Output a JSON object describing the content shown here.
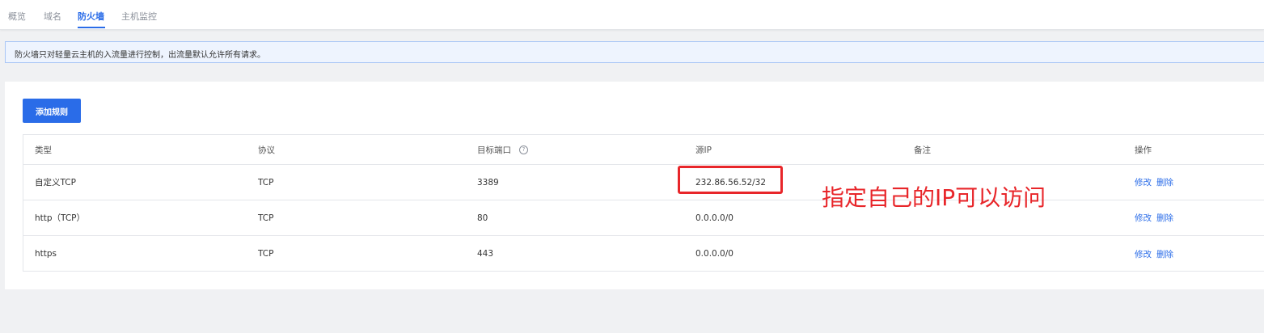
{
  "tabs": [
    {
      "label": "概览",
      "active": false
    },
    {
      "label": "域名",
      "active": false
    },
    {
      "label": "防火墙",
      "active": true
    },
    {
      "label": "主机监控",
      "active": false
    }
  ],
  "notice": {
    "text": "防火墙只对轻量云主机的入流量进行控制，出流量默认允许所有请求。"
  },
  "toolbar": {
    "add_rule_label": "添加规则"
  },
  "table": {
    "headers": {
      "type": "类型",
      "protocol": "协议",
      "port": "目标端口",
      "source_ip": "源IP",
      "remark": "备注",
      "actions": "操作"
    },
    "help_icon": "question-circle-icon",
    "rows": [
      {
        "type": "自定义TCP",
        "protocol": "TCP",
        "port": "3389",
        "source_ip": "232.86.56.52/32",
        "remark": "",
        "edit": "修改",
        "delete": "删除"
      },
      {
        "type": "http（TCP）",
        "protocol": "TCP",
        "port": "80",
        "source_ip": "0.0.0.0/0",
        "remark": "",
        "edit": "修改",
        "delete": "删除"
      },
      {
        "type": "https",
        "protocol": "TCP",
        "port": "443",
        "source_ip": "0.0.0.0/0",
        "remark": "",
        "edit": "修改",
        "delete": "删除"
      }
    ]
  },
  "annotation": {
    "text": "指定自己的IP可以访问",
    "color": "#e8262a"
  },
  "colors": {
    "accent": "#2a6ce8",
    "notice_bg": "#eef4fe",
    "notice_border": "#a9c6f5"
  }
}
